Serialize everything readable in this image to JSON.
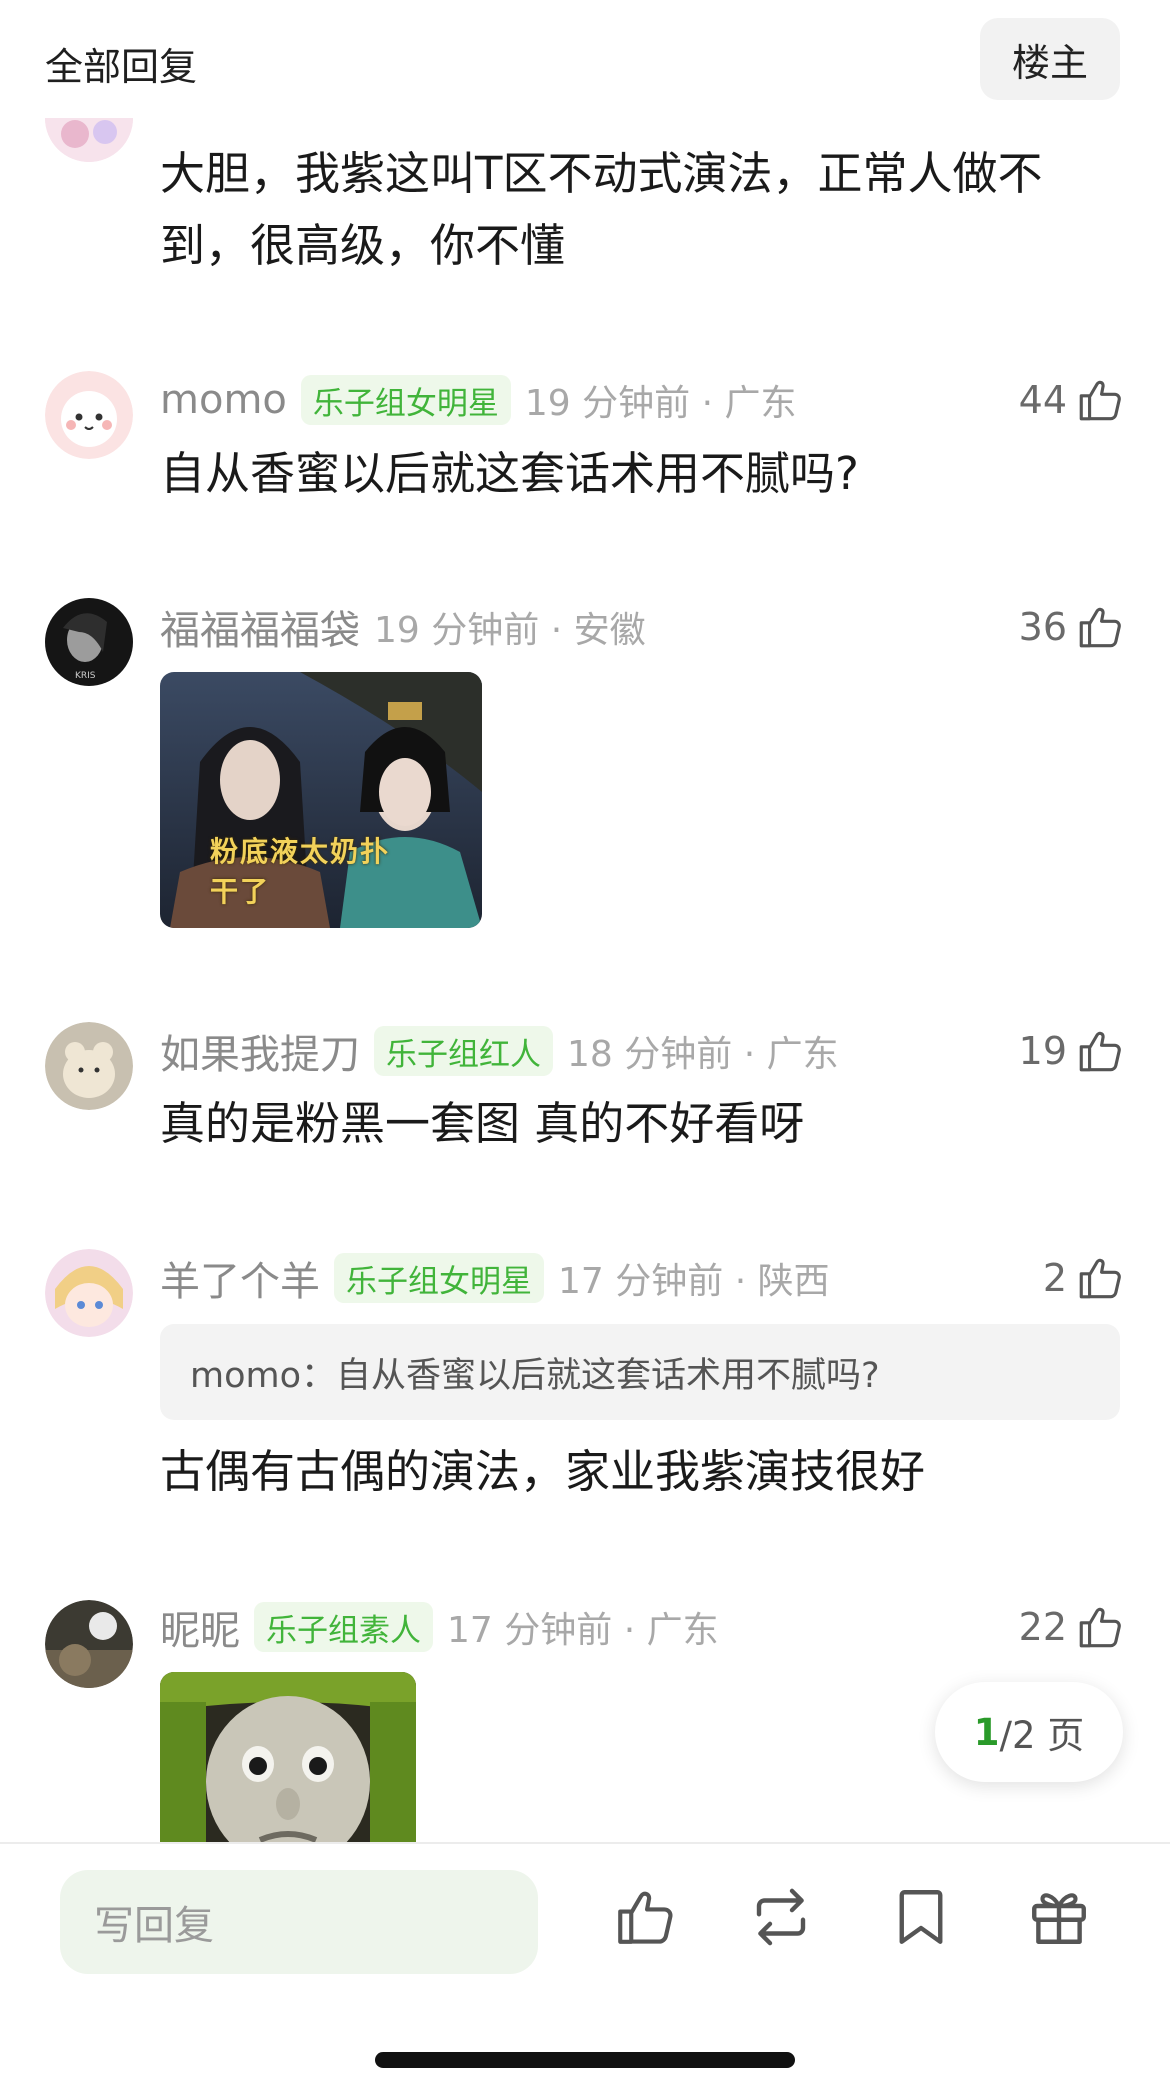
{
  "header": {
    "title": "全部回复",
    "op_button": "楼主"
  },
  "comments": [
    {
      "text": "大胆，我紫这叫T区不动式演法，正常人做不到，很高级，你不懂"
    },
    {
      "username": "momo",
      "tag": "乐子组女明星",
      "time": "19 分钟前 · 广东",
      "likes": "44",
      "text": "自从香蜜以后就这套话术用不腻吗?"
    },
    {
      "username": "福福福福袋",
      "time": "19 分钟前 · 安徽",
      "likes": "36",
      "image_caption": "粉底液太奶扑干了"
    },
    {
      "username": "如果我提刀",
      "tag": "乐子组红人",
      "time": "18 分钟前 · 广东",
      "likes": "19",
      "text": "真的是粉黑一套图 真的不好看呀"
    },
    {
      "username": "羊了个羊",
      "tag": "乐子组女明星",
      "time": "17 分钟前 · 陕西",
      "likes": "2",
      "quote": "momo：自从香蜜以后就这套话术用不腻吗?",
      "text": "古偶有古偶的演法，家业我紫演技很好"
    },
    {
      "username": "昵昵",
      "tag": "乐子组素人",
      "time": "17 分钟前 · 广东",
      "likes": "22"
    }
  ],
  "pager": {
    "current": "1",
    "total_text": "/2 页"
  },
  "bottom_bar": {
    "reply_placeholder": "写回复",
    "icons": [
      "thumbs-up-icon",
      "repost-icon",
      "bookmark-icon",
      "gift-icon"
    ]
  },
  "colors": {
    "tag_green": "#41b43a",
    "tag_bg": "#eef8ea",
    "input_bg": "#eef5ec",
    "page_green": "#2a9a2a"
  }
}
